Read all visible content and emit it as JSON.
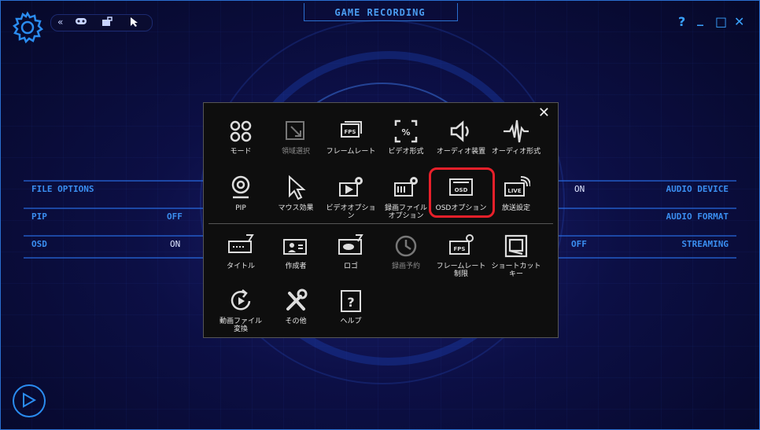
{
  "window": {
    "title": "GAME RECORDING",
    "controls": [
      "?",
      "_",
      "□",
      "✕"
    ]
  },
  "toolbar": {
    "icons": [
      "double-chevron-left-icon",
      "gamepad-icon",
      "webcam-lock-icon",
      "cursor-icon"
    ]
  },
  "left_panel": [
    {
      "label": "FILE OPTIONS",
      "value": ""
    },
    {
      "label": "PIP",
      "value": "OFF"
    },
    {
      "label": "OSD",
      "value": "ON"
    }
  ],
  "right_panel": [
    {
      "label": "AUDIO DEVICE",
      "value": "ON"
    },
    {
      "label": "AUDIO FORMAT",
      "value": ""
    },
    {
      "label": "STREAMING",
      "value": "OFF"
    }
  ],
  "menu": {
    "close": "✕",
    "row1": [
      {
        "label": "モード",
        "icon": "mode-icon",
        "enabled": true
      },
      {
        "label": "領域選択",
        "icon": "region-select-icon",
        "enabled": false
      },
      {
        "label": "フレームレート",
        "icon": "fps-icon",
        "enabled": true
      },
      {
        "label": "ビデオ形式",
        "icon": "video-format-icon",
        "enabled": true
      },
      {
        "label": "オーディオ装置",
        "icon": "audio-device-icon",
        "enabled": true
      },
      {
        "label": "オーディオ形式",
        "icon": "audio-format-icon",
        "enabled": true
      }
    ],
    "row2": [
      {
        "label": "PIP",
        "icon": "webcam-icon",
        "enabled": true
      },
      {
        "label": "マウス効果",
        "icon": "mouse-cursor-icon",
        "enabled": true
      },
      {
        "label": "ビデオオプション",
        "icon": "video-options-icon",
        "enabled": true
      },
      {
        "label": "録画ファイル\nオプション",
        "icon": "record-file-options-icon",
        "enabled": true
      },
      {
        "label": "OSDオプション",
        "icon": "osd-icon",
        "enabled": true,
        "selected": true
      },
      {
        "label": "放送設定",
        "icon": "live-broadcast-icon",
        "enabled": true
      }
    ],
    "row3": [
      {
        "label": "タイトル",
        "icon": "title-icon",
        "enabled": true
      },
      {
        "label": "作成者",
        "icon": "author-icon",
        "enabled": true
      },
      {
        "label": "ロゴ",
        "icon": "logo-icon",
        "enabled": true
      },
      {
        "label": "録画予約",
        "icon": "schedule-clock-icon",
        "enabled": false
      },
      {
        "label": "フレームレート\n制限",
        "icon": "fps-limit-icon",
        "enabled": true
      },
      {
        "label": "ショートカット\nキー",
        "icon": "shortcut-key-icon",
        "enabled": true
      }
    ],
    "row4": [
      {
        "label": "動画ファイル\n変換",
        "icon": "video-convert-icon",
        "enabled": true
      },
      {
        "label": "その他",
        "icon": "tools-icon",
        "enabled": true
      },
      {
        "label": "ヘルプ",
        "icon": "help-icon",
        "enabled": true
      }
    ]
  },
  "colors": {
    "accent": "#3a8ef0",
    "highlight": "#e8202a",
    "menu_bg": "#0e0e0e"
  }
}
